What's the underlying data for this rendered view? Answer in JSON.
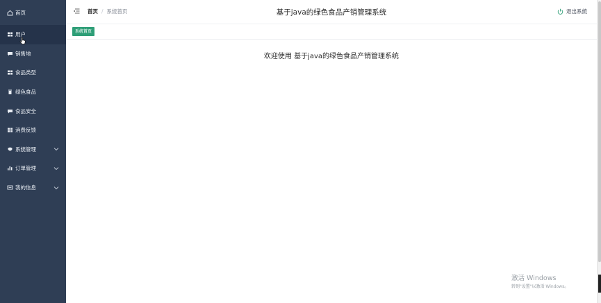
{
  "sidebar": {
    "items": [
      {
        "label": "首页",
        "icon": "home-icon"
      },
      {
        "label": "用户",
        "icon": "grid-icon"
      },
      {
        "label": "销售地",
        "icon": "chat-icon"
      },
      {
        "label": "食品类型",
        "icon": "grid-icon"
      },
      {
        "label": "绿色食品",
        "icon": "trash-icon"
      },
      {
        "label": "食品安全",
        "icon": "chat-icon"
      },
      {
        "label": "消费反馈",
        "icon": "grid-icon"
      },
      {
        "label": "系统管理",
        "icon": "shield-icon"
      },
      {
        "label": "订单管理",
        "icon": "bar-chart-icon"
      },
      {
        "label": "我的信息",
        "icon": "card-icon"
      }
    ]
  },
  "header": {
    "breadcrumb_home": "首页",
    "breadcrumb_sep": "/",
    "breadcrumb_current": "系统首页",
    "title": "基于java的绿色食品产销管理系统",
    "logout_label": "退出系统"
  },
  "tags": {
    "active_tag": "系统首页"
  },
  "main": {
    "welcome": "欢迎使用 基于java的绿色食品产销管理系统"
  },
  "watermark": {
    "line1": "激活 Windows",
    "line2": "转到\"设置\"以激活 Windows。"
  },
  "colors": {
    "sidebar_bg": "#2f3e55",
    "accent_green": "#2e9e77",
    "logout_icon": "#2e9e77"
  }
}
